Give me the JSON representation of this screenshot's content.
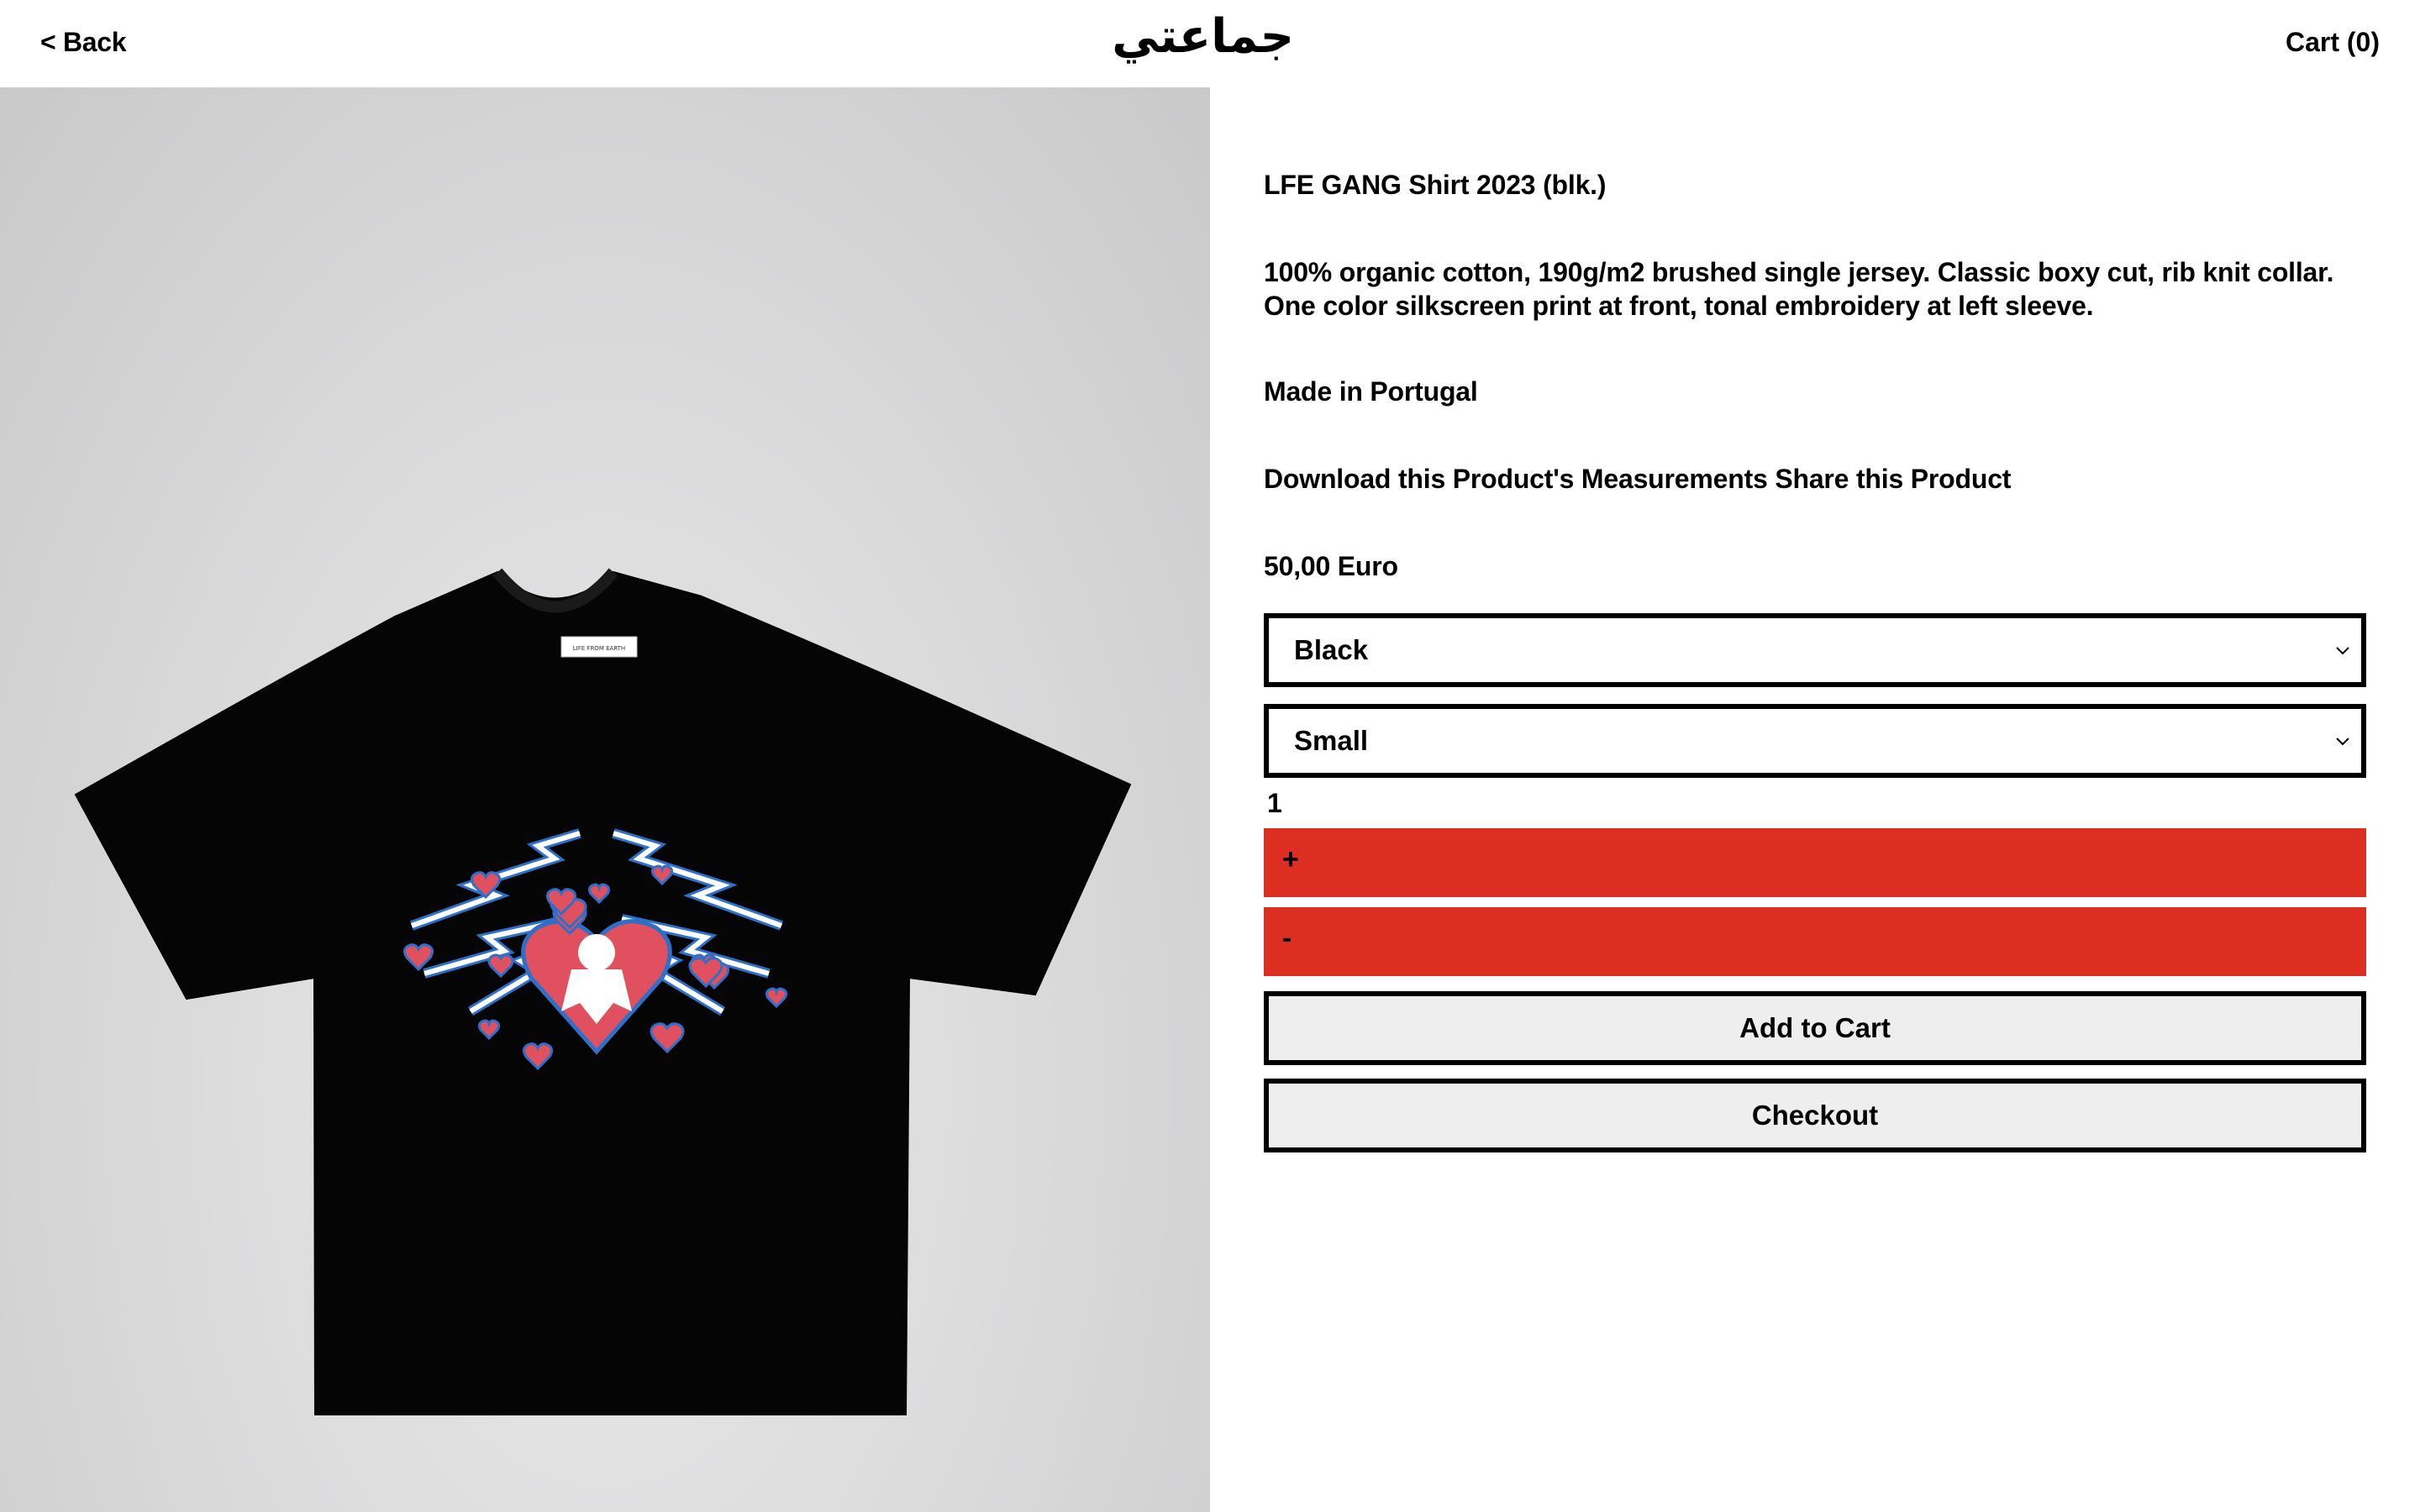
{
  "header": {
    "back_label": "< Back",
    "logo_text": "جماعتي",
    "cart_label": "Cart (0)"
  },
  "product": {
    "title": "LFE GANG Shirt 2023 (blk.)",
    "description": "100% organic cotton, 190g/m2 brushed single jersey. Classic boxy cut, rib knit collar. One color silkscreen print at front, tonal embroidery at left sleeve.",
    "origin": "Made in Portugal",
    "download_link": "Download this Product's Measurements",
    "share_link": "Share this Product",
    "price": "50,00 Euro",
    "image_label_text": "LIFE FROM EARTH"
  },
  "options": {
    "color_value": "Black",
    "size_value": "Small"
  },
  "quantity": {
    "value": "1",
    "plus_label": "+",
    "minus_label": "-"
  },
  "actions": {
    "add_to_cart_label": "Add to Cart",
    "checkout_label": "Checkout"
  },
  "icons": {
    "select_arrow": "chevron-down-icon"
  },
  "colors": {
    "accent_red": "#dc2f22",
    "button_grey": "#eeeeee",
    "image_bg": "#d8d8d9"
  }
}
